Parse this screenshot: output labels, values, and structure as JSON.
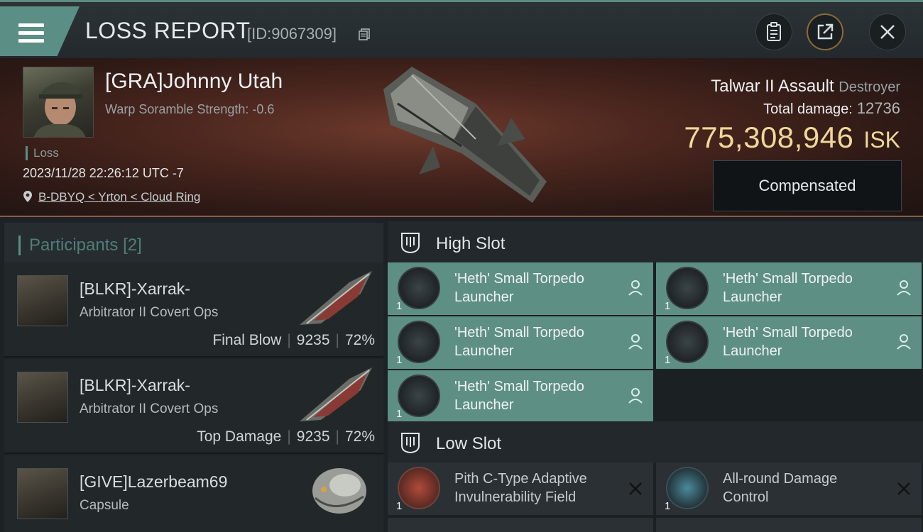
{
  "header": {
    "title": "LOSS REPORT",
    "report_id": "[ID:9067309]"
  },
  "victim": {
    "name": "[GRA]Johnny Utah",
    "warp_scramble": "Warp Soramble Strength: -0.6",
    "status": "Loss",
    "timestamp": "2023/11/28 22:26:12 UTC -7",
    "location": "B-DBYQ < Yrton < Cloud Ring"
  },
  "ship": {
    "name": "Talwar II Assault",
    "class": "Destroyer",
    "damage_label": "Total damage:",
    "damage_value": "12736",
    "isk_value": "775,308,946",
    "isk_unit": "ISK",
    "compensated_label": "Compensated"
  },
  "participants": {
    "title": "Participants",
    "count": "[2]",
    "rows": [
      {
        "name": "[BLKR]-Xarrak-",
        "ship": "Arbitrator II Covert Ops",
        "role": "Final Blow",
        "damage": "9235",
        "percent": "72%"
      },
      {
        "name": "[BLKR]-Xarrak-",
        "ship": "Arbitrator II Covert Ops",
        "role": "Top Damage",
        "damage": "9235",
        "percent": "72%"
      },
      {
        "name": "[GIVE]Lazerbeam69",
        "ship": "Capsule"
      }
    ]
  },
  "slots": {
    "high": {
      "title": "High Slot",
      "modules": [
        {
          "line1": "'Heth' Small Torpedo",
          "line2": "Launcher",
          "qty": "1"
        },
        {
          "line1": "'Heth' Small Torpedo",
          "line2": "Launcher",
          "qty": "1"
        },
        {
          "line1": "'Heth' Small Torpedo",
          "line2": "Launcher",
          "qty": "1"
        },
        {
          "line1": "'Heth' Small Torpedo",
          "line2": "Launcher",
          "qty": "1"
        },
        {
          "line1": "'Heth' Small Torpedo",
          "line2": "Launcher",
          "qty": "1"
        }
      ]
    },
    "low": {
      "title": "Low Slot",
      "modules": [
        {
          "line1": "Pith C-Type Adaptive",
          "line2": "Invulnerability Field",
          "qty": "1"
        },
        {
          "line1": "All-round Damage",
          "line2": "Control",
          "qty": "1"
        }
      ]
    }
  },
  "colors": {
    "accent": "#5b8f85",
    "isk": "#f0d89a",
    "dropped_module": "#5e8f85",
    "destroyed_module": "#2a3034"
  },
  "icons": [
    "menu-icon",
    "copy-icon",
    "clipboard-icon",
    "share-icon",
    "close-icon",
    "location-pin-icon",
    "slot-icon",
    "pilot-icon",
    "destroyed-x-icon"
  ]
}
